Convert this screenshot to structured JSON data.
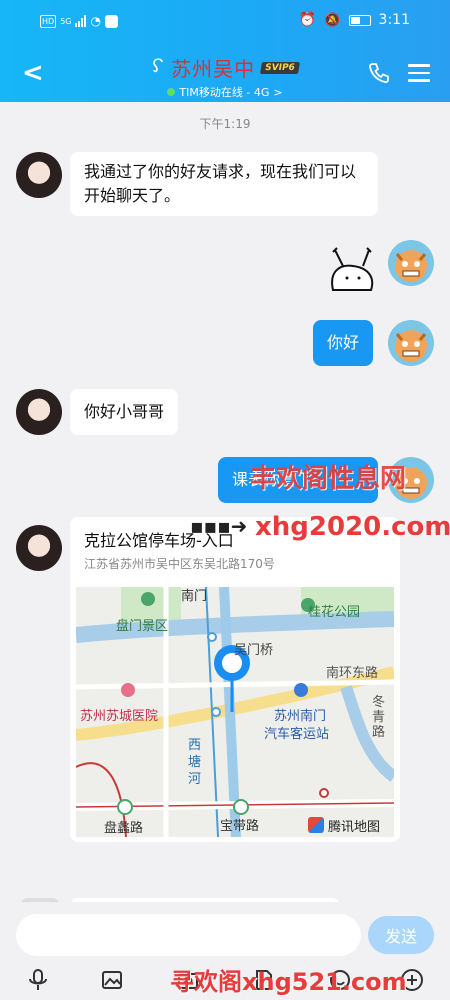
{
  "status_bar": {
    "network": "HD",
    "signal": "5G",
    "time": "3:11"
  },
  "header": {
    "title": "苏州吴中",
    "vip_badge": "SVIP6",
    "subtitle": "TIM移动在线 - 4G",
    "subtitle_chevron": ">",
    "back_glyph": "<"
  },
  "chat": {
    "timestamp": "下午1:19",
    "messages": [
      {
        "sender": "contact",
        "text": "我通过了你的好友请求，现在我们可以开始聊天了。"
      },
      {
        "sender": "me",
        "type": "sticker"
      },
      {
        "sender": "me",
        "text": "你好"
      },
      {
        "sender": "contact",
        "text": "你好小哥哥"
      },
      {
        "sender": "me",
        "text": "课表你看下"
      }
    ],
    "location_card": {
      "title": "克拉公馆停车场-入口",
      "address": "江苏省苏州市吴中区东吴北路170号",
      "map_labels": {
        "top_road": "南门",
        "panmen": "盘门景区",
        "guihua": "桂花公园",
        "wumen": "吴门桥",
        "nanhuan": "南环东路",
        "hospital": "苏州苏城医院",
        "bus": "苏州南门",
        "bus2": "汽车客运站",
        "dongwu": "冬青路",
        "xitang": "西塘河",
        "panli": "盘蠡路",
        "baodai": "宝带路",
        "provider": "腾讯地图"
      }
    }
  },
  "watermarks": {
    "top": "丰欢阁性息网",
    "url1": "xhg2020.com",
    "bottom": "寻欢阁xhg521.com"
  },
  "input": {
    "placeholder": "",
    "send_label": "发送"
  },
  "colors": {
    "header": "#1ea9f5",
    "bubble_out": "#1898f2",
    "title": "#d4323a",
    "send_disabled": "#a9d6fa"
  }
}
